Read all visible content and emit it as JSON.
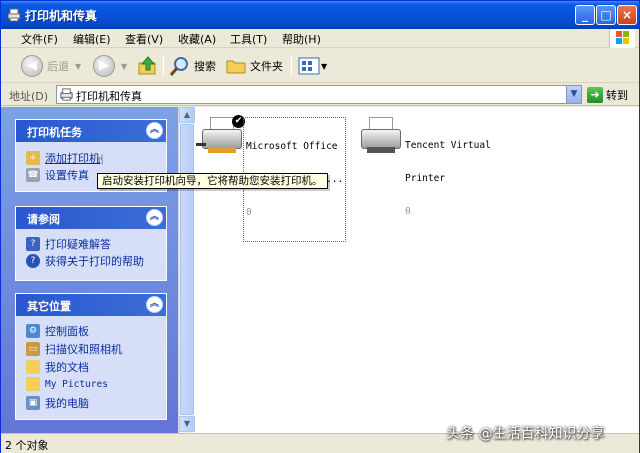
{
  "window": {
    "title": "打印机和传真",
    "controls": {
      "minimize": "_",
      "maximize": "□",
      "close": "×"
    }
  },
  "menu": [
    {
      "label": "文件(F)"
    },
    {
      "label": "编辑(E)"
    },
    {
      "label": "查看(V)"
    },
    {
      "label": "收藏(A)"
    },
    {
      "label": "工具(T)"
    },
    {
      "label": "帮助(H)"
    }
  ],
  "toolbar": {
    "back_label": "后退",
    "search_label": "搜索",
    "folders_label": "文件夹"
  },
  "address": {
    "label": "地址(D)",
    "value": "打印机和传真",
    "go_label": "转到"
  },
  "panels": {
    "printer_tasks": {
      "title": "打印机任务",
      "items": [
        "添加打印机",
        "设置传真"
      ]
    },
    "see_also": {
      "title": "请参阅",
      "items": [
        "打印疑难解答",
        "获得关于打印的帮助"
      ]
    },
    "other_places": {
      "title": "其它位置",
      "items": [
        "控制面板",
        "扫描仪和照相机",
        "我的文档",
        "My Pictures",
        "我的电脑"
      ]
    }
  },
  "printers": [
    {
      "name_line1": "Microsoft Office",
      "name_line2": "Document Image...",
      "jobs": "0",
      "default": true
    },
    {
      "name_line1": "Tencent Virtual",
      "name_line2": "Printer",
      "jobs": "0",
      "default": false
    }
  ],
  "tooltip": "启动安装打印机向导，它将帮助您安装打印机。",
  "status": "2 个对象",
  "watermark": "头条 @生活百科知识分享",
  "colors": {
    "title_bar": "#0751d9",
    "task_pane_bg": "#6f8de0",
    "panel_header": "#2a57cf",
    "link": "#0c2d9e"
  }
}
